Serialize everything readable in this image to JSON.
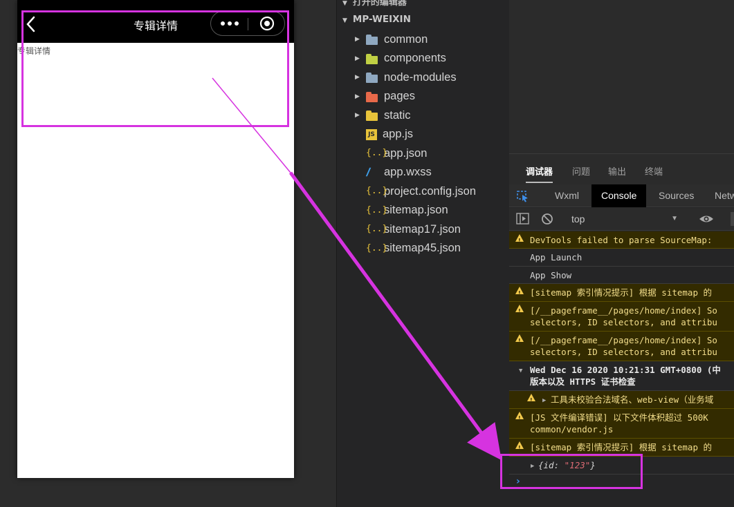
{
  "simulator": {
    "nav_title": "专辑详情",
    "page_text": "专辑详情"
  },
  "explorer": {
    "open_editors_label": "打开的编辑器",
    "project_name": "MP-WEIXIN",
    "items": [
      {
        "label": "common",
        "type": "folder",
        "color": "#8fa8c0"
      },
      {
        "label": "components",
        "type": "folder",
        "color": "#c0d044"
      },
      {
        "label": "node-modules",
        "type": "folder",
        "color": "#8fa8c0"
      },
      {
        "label": "pages",
        "type": "folder",
        "color": "#e8694a"
      },
      {
        "label": "static",
        "type": "folder",
        "color": "#e8c33a"
      },
      {
        "label": "app.js",
        "type": "js"
      },
      {
        "label": "app.json",
        "type": "json"
      },
      {
        "label": "app.wxss",
        "type": "css"
      },
      {
        "label": "project.config.json",
        "type": "json"
      },
      {
        "label": "sitemap.json",
        "type": "json"
      },
      {
        "label": "sitemap17.json",
        "type": "json"
      },
      {
        "label": "sitemap45.json",
        "type": "json"
      }
    ]
  },
  "debugger": {
    "tabs": [
      "调试器",
      "问题",
      "输出",
      "终端"
    ],
    "panel_tabs": [
      "Wxml",
      "Console",
      "Sources",
      "Netw"
    ],
    "context": "top",
    "logs": [
      {
        "level": "warn",
        "line1": "DevTools failed to parse SourceMap: "
      },
      {
        "level": "info",
        "line1": "App Launch"
      },
      {
        "level": "info",
        "line1": "App Show"
      },
      {
        "level": "warn",
        "line1": "[sitemap 索引情况提示] 根据 sitemap 的"
      },
      {
        "level": "warn",
        "line1": "[/__pageframe__/pages/home/index] So",
        "line2": "selectors, ID selectors, and attribu"
      },
      {
        "level": "warn",
        "line1": "[/__pageframe__/pages/home/index] So",
        "line2": "selectors, ID selectors, and attribu"
      },
      {
        "level": "group",
        "line1": "Wed Dec 16 2020 10:21:31 GMT+0800 (中",
        "line2": "版本以及 HTTPS 证书检查"
      },
      {
        "level": "warn",
        "line1": "工具未校验合法域名、web-view（业务域"
      },
      {
        "level": "warn",
        "line1": "[JS 文件编译错误] 以下文件体积超过 500K",
        "line2": "common/vendor.js"
      },
      {
        "level": "warn",
        "line1": "[sitemap 索引情况提示] 根据 sitemap 的"
      }
    ],
    "object_log": {
      "key": "id",
      "value": "\"123\""
    }
  },
  "annotation_color": "#d633e0"
}
